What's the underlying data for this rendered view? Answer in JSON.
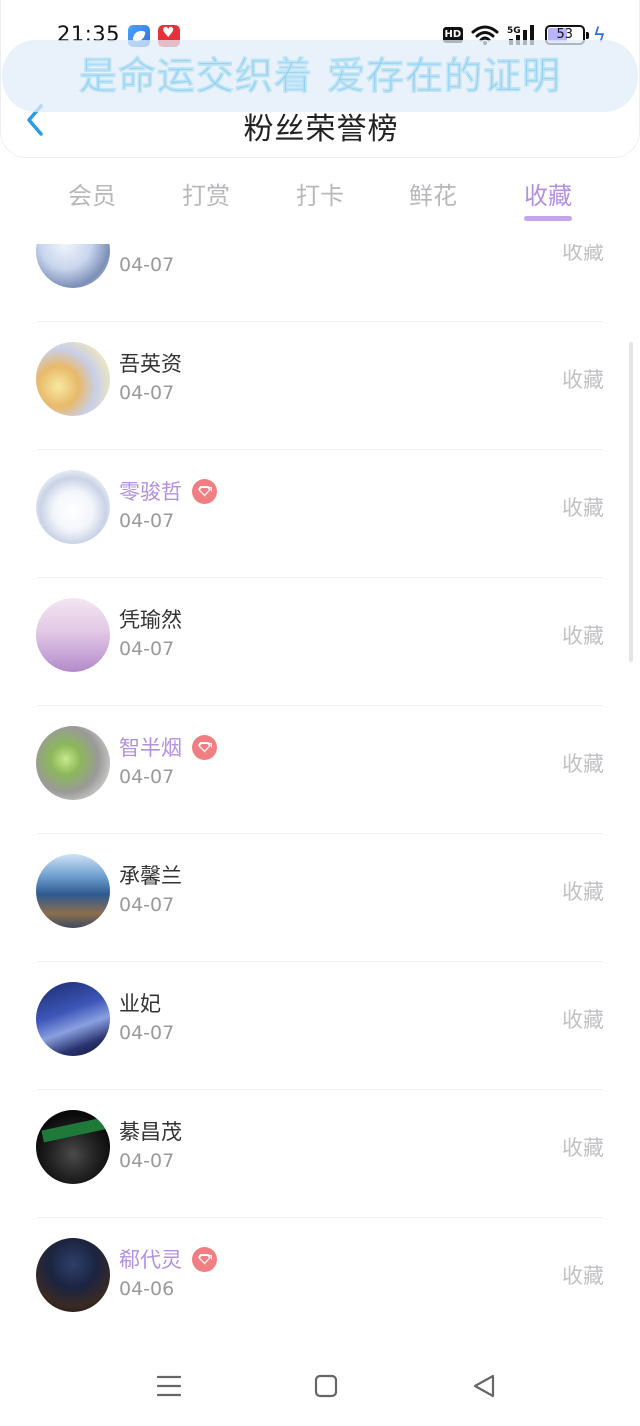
{
  "status_bar": {
    "time": "21:35",
    "hd": "HD",
    "battery": "53",
    "battery_level": 0.53
  },
  "lyric": "是命运交织着 爱存在的证明",
  "header": {
    "title": "粉丝荣誉榜",
    "back_icon": "chevron-left-icon"
  },
  "tabs": [
    {
      "label": "会员",
      "active": false
    },
    {
      "label": "打赏",
      "active": false
    },
    {
      "label": "打卡",
      "active": false
    },
    {
      "label": "鲜花",
      "active": false
    },
    {
      "label": "收藏",
      "active": true
    }
  ],
  "colors": {
    "accent": "#b390e0",
    "vip_badge": "#f07f84",
    "muted": "#c2c2c6",
    "back_arrow": "#2b9be6"
  },
  "list": {
    "items": [
      {
        "name": "",
        "date": "04-07",
        "action": "收藏",
        "vip": false
      },
      {
        "name": "吾英资",
        "date": "04-07",
        "action": "收藏",
        "vip": false
      },
      {
        "name": "零骏哲",
        "date": "04-07",
        "action": "收藏",
        "vip": true
      },
      {
        "name": "凭瑜然",
        "date": "04-07",
        "action": "收藏",
        "vip": false
      },
      {
        "name": "智半烟",
        "date": "04-07",
        "action": "收藏",
        "vip": true
      },
      {
        "name": "承馨兰",
        "date": "04-07",
        "action": "收藏",
        "vip": false
      },
      {
        "name": "业妃",
        "date": "04-07",
        "action": "收藏",
        "vip": false
      },
      {
        "name": "綦昌茂",
        "date": "04-07",
        "action": "收藏",
        "vip": false
      },
      {
        "name": "郗代灵",
        "date": "04-06",
        "action": "收藏",
        "vip": true
      }
    ]
  },
  "nav_bar": {
    "menu_icon": "menu-icon",
    "home_icon": "home-square-icon",
    "back_icon": "back-triangle-icon"
  }
}
